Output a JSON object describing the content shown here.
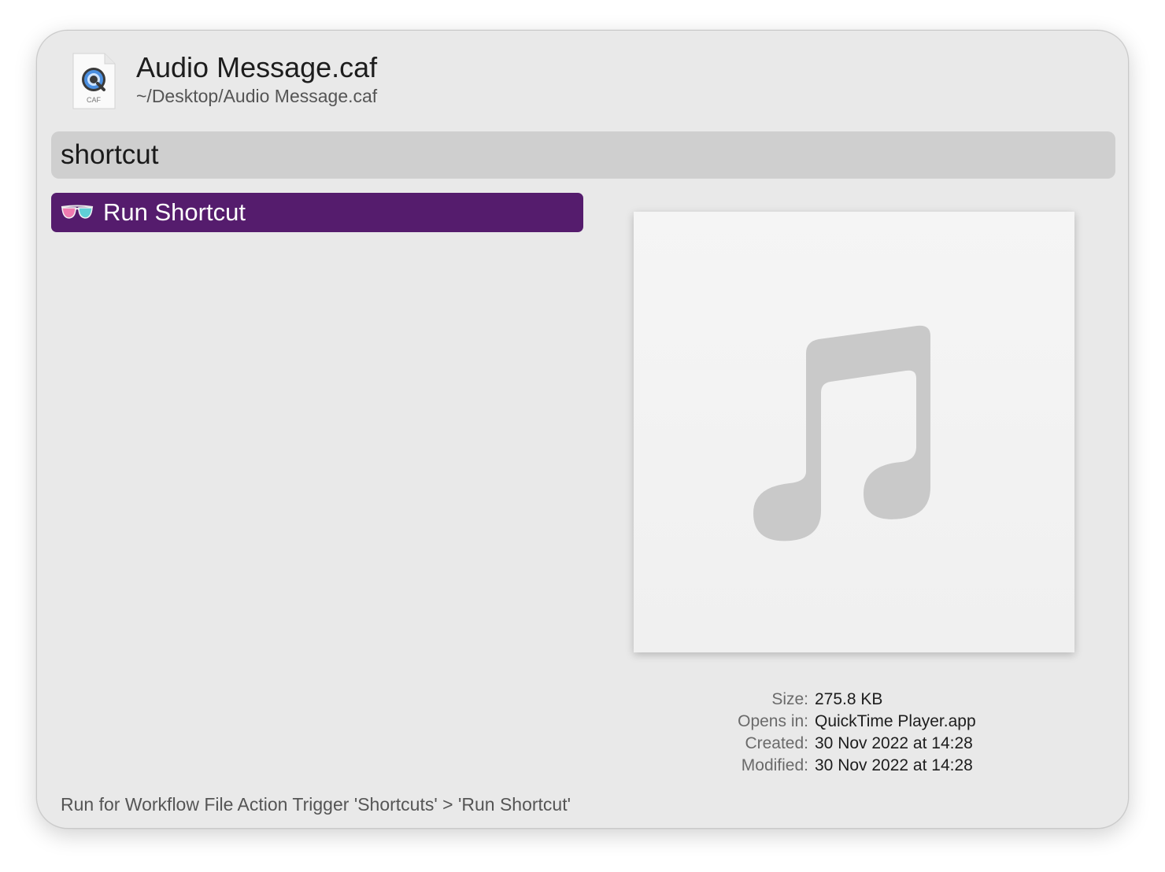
{
  "header": {
    "file_title": "Audio Message.caf",
    "file_path": "~/Desktop/Audio Message.caf",
    "file_icon": "quicktime-caf-file-icon",
    "file_icon_badge": "CAF"
  },
  "search": {
    "value": "shortcut"
  },
  "results": [
    {
      "label": "Run Shortcut",
      "icon": "sunglasses-icon",
      "selected": true
    }
  ],
  "preview": {
    "icon": "music-note-icon"
  },
  "details": {
    "size_label": "Size:",
    "size_value": "275.8 KB",
    "opens_in_label": "Opens in:",
    "opens_in_value": "QuickTime Player.app",
    "created_label": "Created:",
    "created_value": "30 Nov 2022 at 14:28",
    "modified_label": "Modified:",
    "modified_value": "30 Nov 2022 at 14:28"
  },
  "footer": {
    "text": "Run for Workflow File Action Trigger 'Shortcuts' > 'Run Shortcut'"
  },
  "colors": {
    "selection": "#551c6d",
    "panel_background": "#e9e9e9",
    "search_background": "#cfcfcf"
  }
}
